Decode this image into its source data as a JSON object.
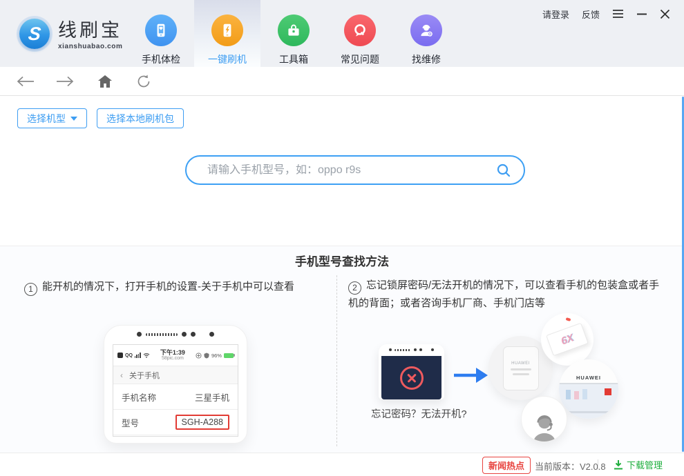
{
  "window": {
    "login": "请登录",
    "feedback": "反馈"
  },
  "header": {
    "brand": "线刷宝",
    "brand_initial": "S",
    "brand_domain": "xianshuabao.com",
    "nav": [
      {
        "label": "手机体检",
        "active": false
      },
      {
        "label": "一键刷机",
        "active": true
      },
      {
        "label": "工具箱",
        "active": false
      },
      {
        "label": "常见问题",
        "active": false
      },
      {
        "label": "找维修",
        "active": false
      }
    ]
  },
  "actions": {
    "select_model": "选择机型",
    "select_local_rom": "选择本地刷机包"
  },
  "search": {
    "placeholder": "请输入手机型号，如：oppo r9s"
  },
  "guide": {
    "title": "手机型号查找方法",
    "steps": [
      {
        "num": "1",
        "text": "能开机的情况下，打开手机的设置-关于手机中可以查看"
      },
      {
        "num": "2",
        "text": "忘记锁屏密码/无法开机的情况下，可以查看手机的包装盒或者手机的背面；或者咨询手机厂商、手机门店等"
      }
    ],
    "phone_mock": {
      "carrier": "QQ",
      "time": "下午1:39",
      "site": "58pic.com",
      "battery": "96%",
      "about": "关于手机",
      "back_chevron": "‹",
      "name_label": "手机名称",
      "name_value": "三星手机",
      "model_label": "型号",
      "model_value": "SGH-A288"
    },
    "locked_caption": "忘记密码？无法开机?",
    "box_text": "6X",
    "store_text": "HUAWEI",
    "card_text": "HUAWEI"
  },
  "footer": {
    "news": "新闻热点",
    "version": "当前版本：V2.0.8",
    "download": "下载管理"
  }
}
